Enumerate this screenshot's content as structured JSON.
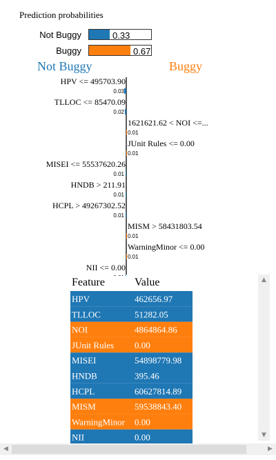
{
  "prediction": {
    "title": "Prediction probabilities",
    "rows": [
      {
        "label": "Not Buggy",
        "value": 0.33,
        "value_text": "0.33",
        "color": "#1f77b4"
      },
      {
        "label": "Buggy",
        "value": 0.67,
        "value_text": "0.67",
        "color": "#ff7f0e"
      }
    ]
  },
  "explanation": {
    "left_class": "Not Buggy",
    "right_class": "Buggy",
    "left_color": "#1f77b4",
    "right_color": "#ff7f0e"
  },
  "chart_data": {
    "type": "bar",
    "features": [
      {
        "label": "HPV <= 495703.90",
        "weight": 0.03,
        "weight_text": "0.03",
        "side": "left"
      },
      {
        "label": "TLLOC <= 85470.09",
        "weight": 0.02,
        "weight_text": "0.02",
        "side": "left"
      },
      {
        "label": "1621621.62 < NOI <=...",
        "weight": 0.01,
        "weight_text": "0.01",
        "side": "right"
      },
      {
        "label": "JUnit Rules <= 0.00",
        "weight": 0.01,
        "weight_text": "0.01",
        "side": "right"
      },
      {
        "label": "MISEI <= 55537620.26",
        "weight": 0.01,
        "weight_text": "0.01",
        "side": "left"
      },
      {
        "label": "HNDB > 211.91",
        "weight": 0.01,
        "weight_text": "0.01",
        "side": "left"
      },
      {
        "label": "HCPL > 49267302.52",
        "weight": 0.01,
        "weight_text": "0.01",
        "side": "left"
      },
      {
        "label": "MISM > 58431803.54",
        "weight": 0.01,
        "weight_text": "0.01",
        "side": "right"
      },
      {
        "label": "WarningMinor <= 0.00",
        "weight": 0.01,
        "weight_text": "0.01",
        "side": "right"
      },
      {
        "label": "NII <= 0.00",
        "weight": 0.01,
        "weight_text": "0.01",
        "side": "left"
      }
    ]
  },
  "feature_table": {
    "header_feature": "Feature",
    "header_value": "Value",
    "rows": [
      {
        "feature": "HPV",
        "value": "462656.97",
        "class": "left"
      },
      {
        "feature": "TLLOC",
        "value": "51282.05",
        "class": "left"
      },
      {
        "feature": "NOI",
        "value": "4864864.86",
        "class": "right"
      },
      {
        "feature": "JUnit Rules",
        "value": "0.00",
        "class": "right"
      },
      {
        "feature": "MISEI",
        "value": "54898779.98",
        "class": "left"
      },
      {
        "feature": "HNDB",
        "value": "395.46",
        "class": "left"
      },
      {
        "feature": "HCPL",
        "value": "60627814.89",
        "class": "left"
      },
      {
        "feature": "MISM",
        "value": "59538843.40",
        "class": "right"
      },
      {
        "feature": "WarningMinor",
        "value": "0.00",
        "class": "right"
      },
      {
        "feature": "NII",
        "value": "0.00",
        "class": "left"
      }
    ]
  },
  "scrollbar": {
    "up_icon": "triangle-up-icon",
    "down_icon": "triangle-down-icon",
    "left_icon": "triangle-left-icon",
    "right_icon": "triangle-right-icon"
  }
}
